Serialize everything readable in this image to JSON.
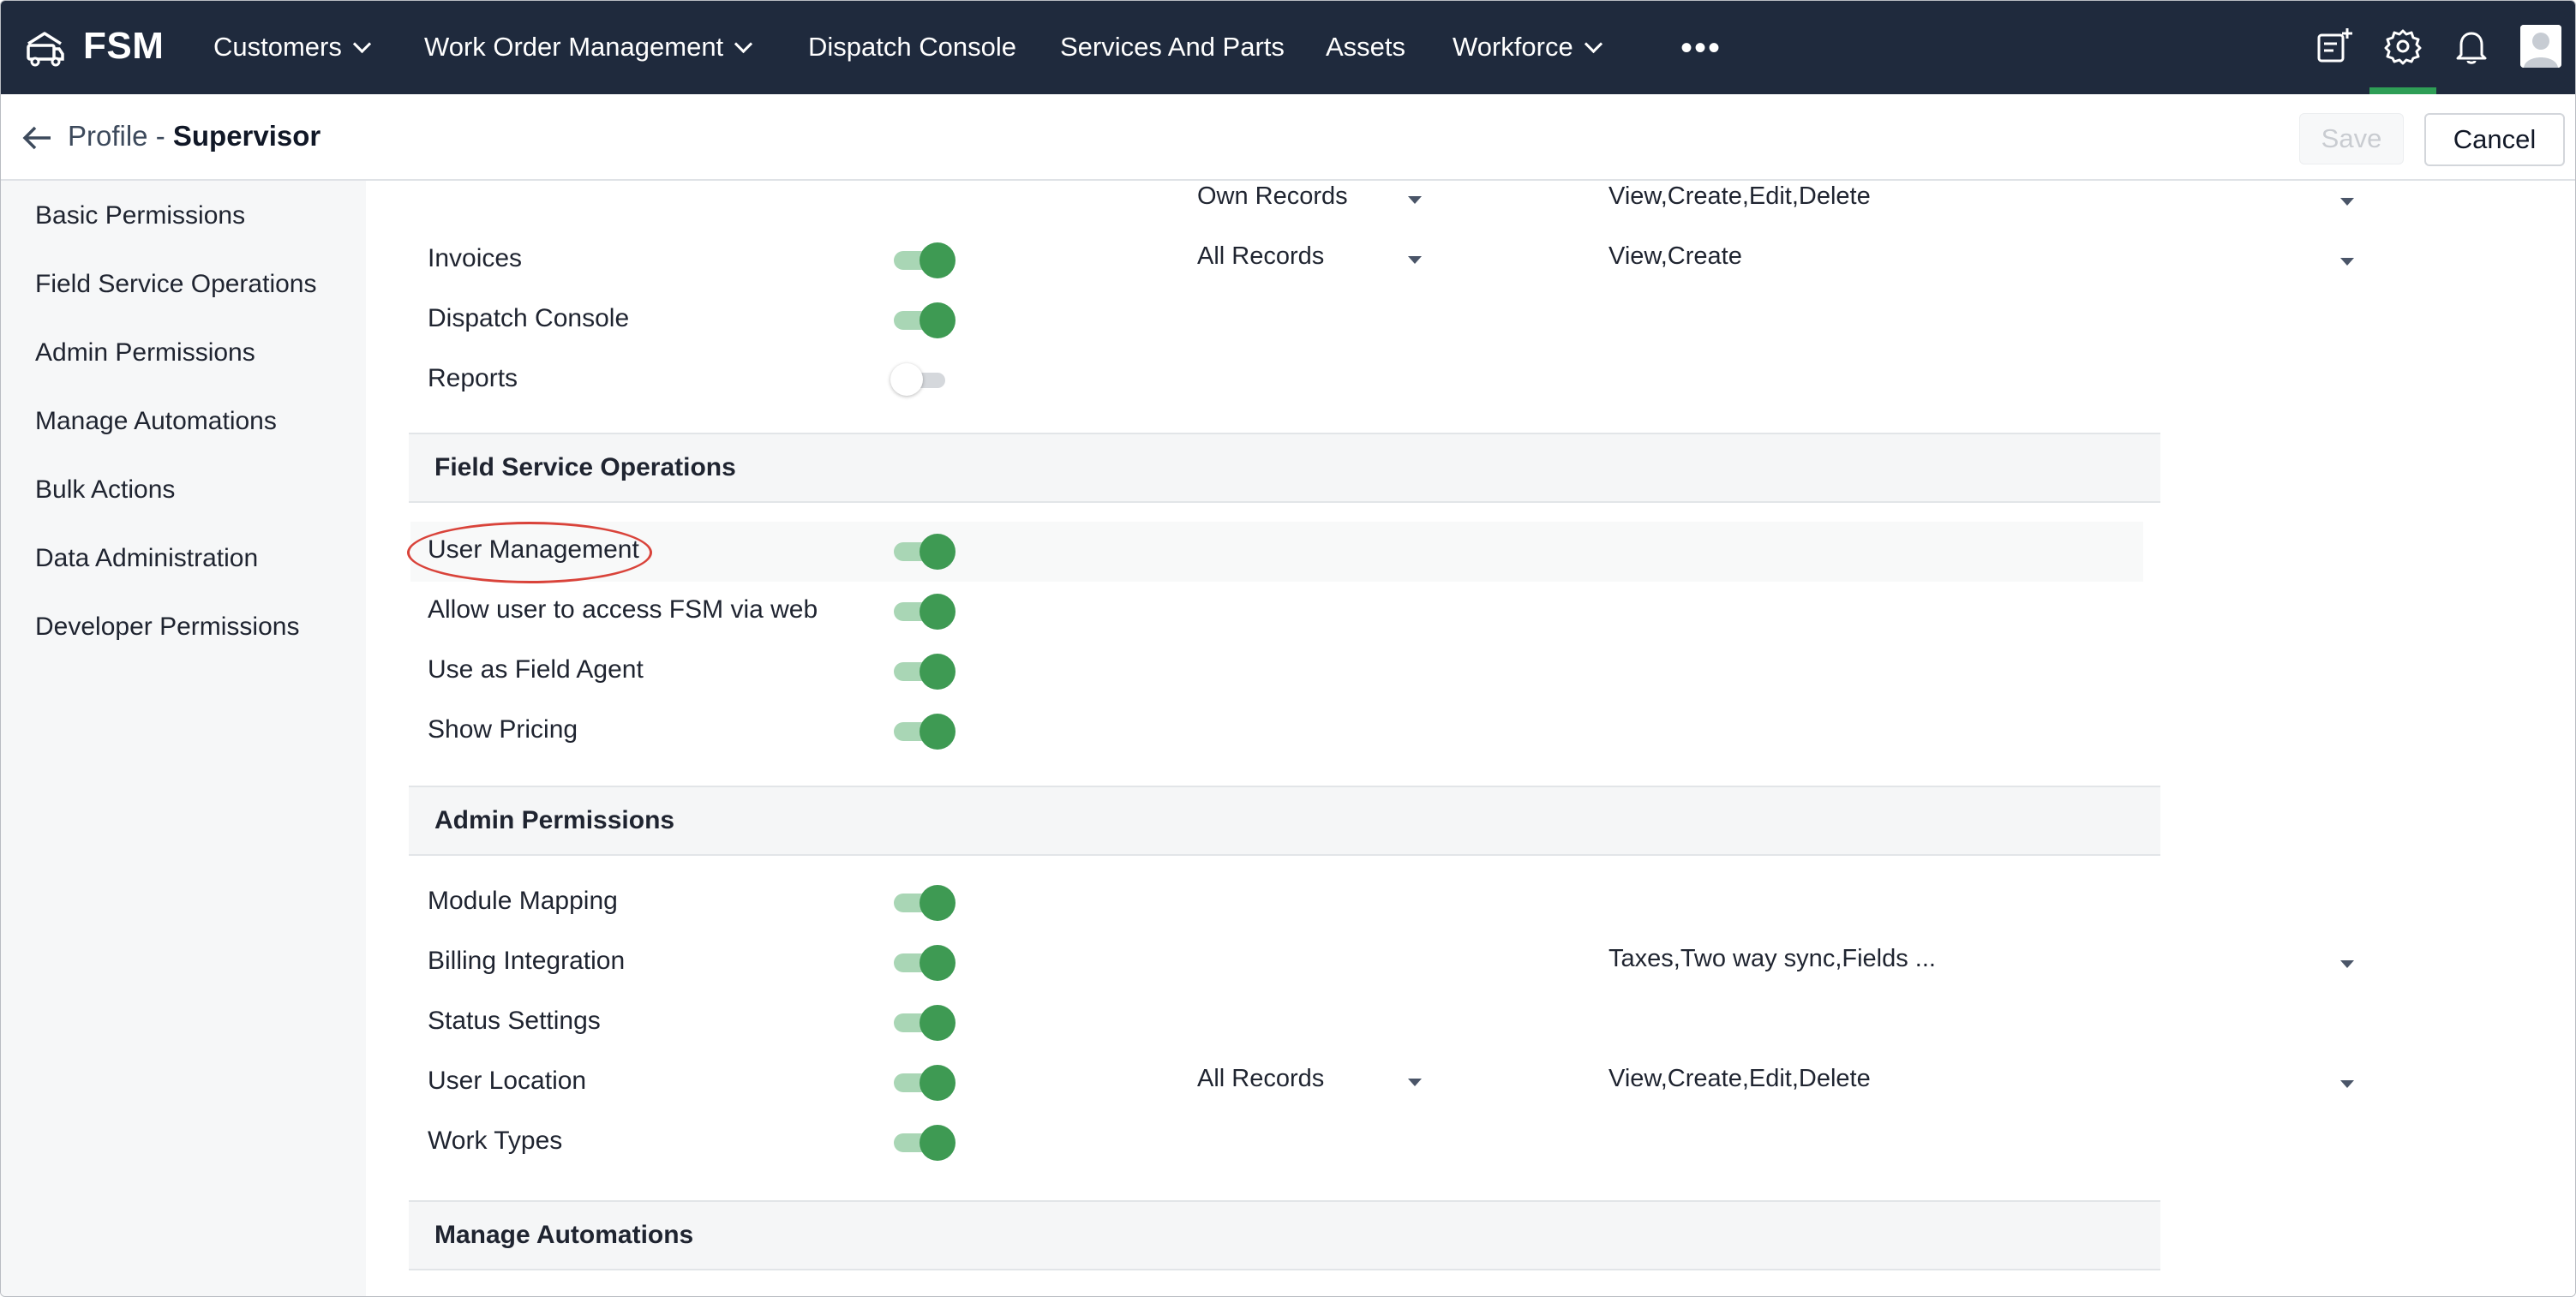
{
  "app": {
    "name": "FSM"
  },
  "nav": {
    "items": [
      {
        "label": "Customers"
      },
      {
        "label": "Work Order Management"
      },
      {
        "label": "Dispatch Console"
      },
      {
        "label": "Services And Parts"
      },
      {
        "label": "Assets"
      },
      {
        "label": "Workforce"
      }
    ],
    "more": "•••"
  },
  "header": {
    "title_prefix": "Profile - ",
    "title_name": "Supervisor",
    "save_label": "Save",
    "cancel_label": "Cancel"
  },
  "sidebar": {
    "items": [
      {
        "label": "Basic Permissions"
      },
      {
        "label": "Field Service Operations"
      },
      {
        "label": "Admin Permissions"
      },
      {
        "label": "Manage Automations"
      },
      {
        "label": "Bulk Actions"
      },
      {
        "label": "Data Administration"
      },
      {
        "label": "Developer Permissions"
      }
    ]
  },
  "basic_rows": [
    {
      "label": "",
      "enabled": true,
      "scope": "Own Records",
      "actions": "View,Create,Edit,Delete"
    },
    {
      "label": "Invoices",
      "enabled": true,
      "scope": "All Records",
      "actions": "View,Create"
    },
    {
      "label": "Dispatch Console",
      "enabled": true
    },
    {
      "label": "Reports",
      "enabled": false
    }
  ],
  "sections": {
    "field_service": {
      "title": "Field Service Operations",
      "rows": [
        {
          "label": "User Management",
          "enabled": true,
          "highlighted": true
        },
        {
          "label": "Allow user to access FSM via web",
          "enabled": true
        },
        {
          "label": "Use as Field Agent",
          "enabled": true
        },
        {
          "label": "Show Pricing",
          "enabled": true
        }
      ]
    },
    "admin": {
      "title": "Admin Permissions",
      "rows": [
        {
          "label": "Module Mapping",
          "enabled": true
        },
        {
          "label": "Billing Integration",
          "enabled": true,
          "actions": "Taxes,Two way sync,Fields ..."
        },
        {
          "label": "Status Settings",
          "enabled": true
        },
        {
          "label": "User Location",
          "enabled": true,
          "scope": "All Records",
          "actions": "View,Create,Edit,Delete"
        },
        {
          "label": "Work Types",
          "enabled": true
        }
      ]
    },
    "automations": {
      "title": "Manage Automations"
    }
  },
  "colors": {
    "nav_bg": "#1f2a3d",
    "toggle_on": "#3e9a53",
    "active_tab_indicator": "#2e9e56",
    "highlight_annotation": "#d9433a"
  }
}
